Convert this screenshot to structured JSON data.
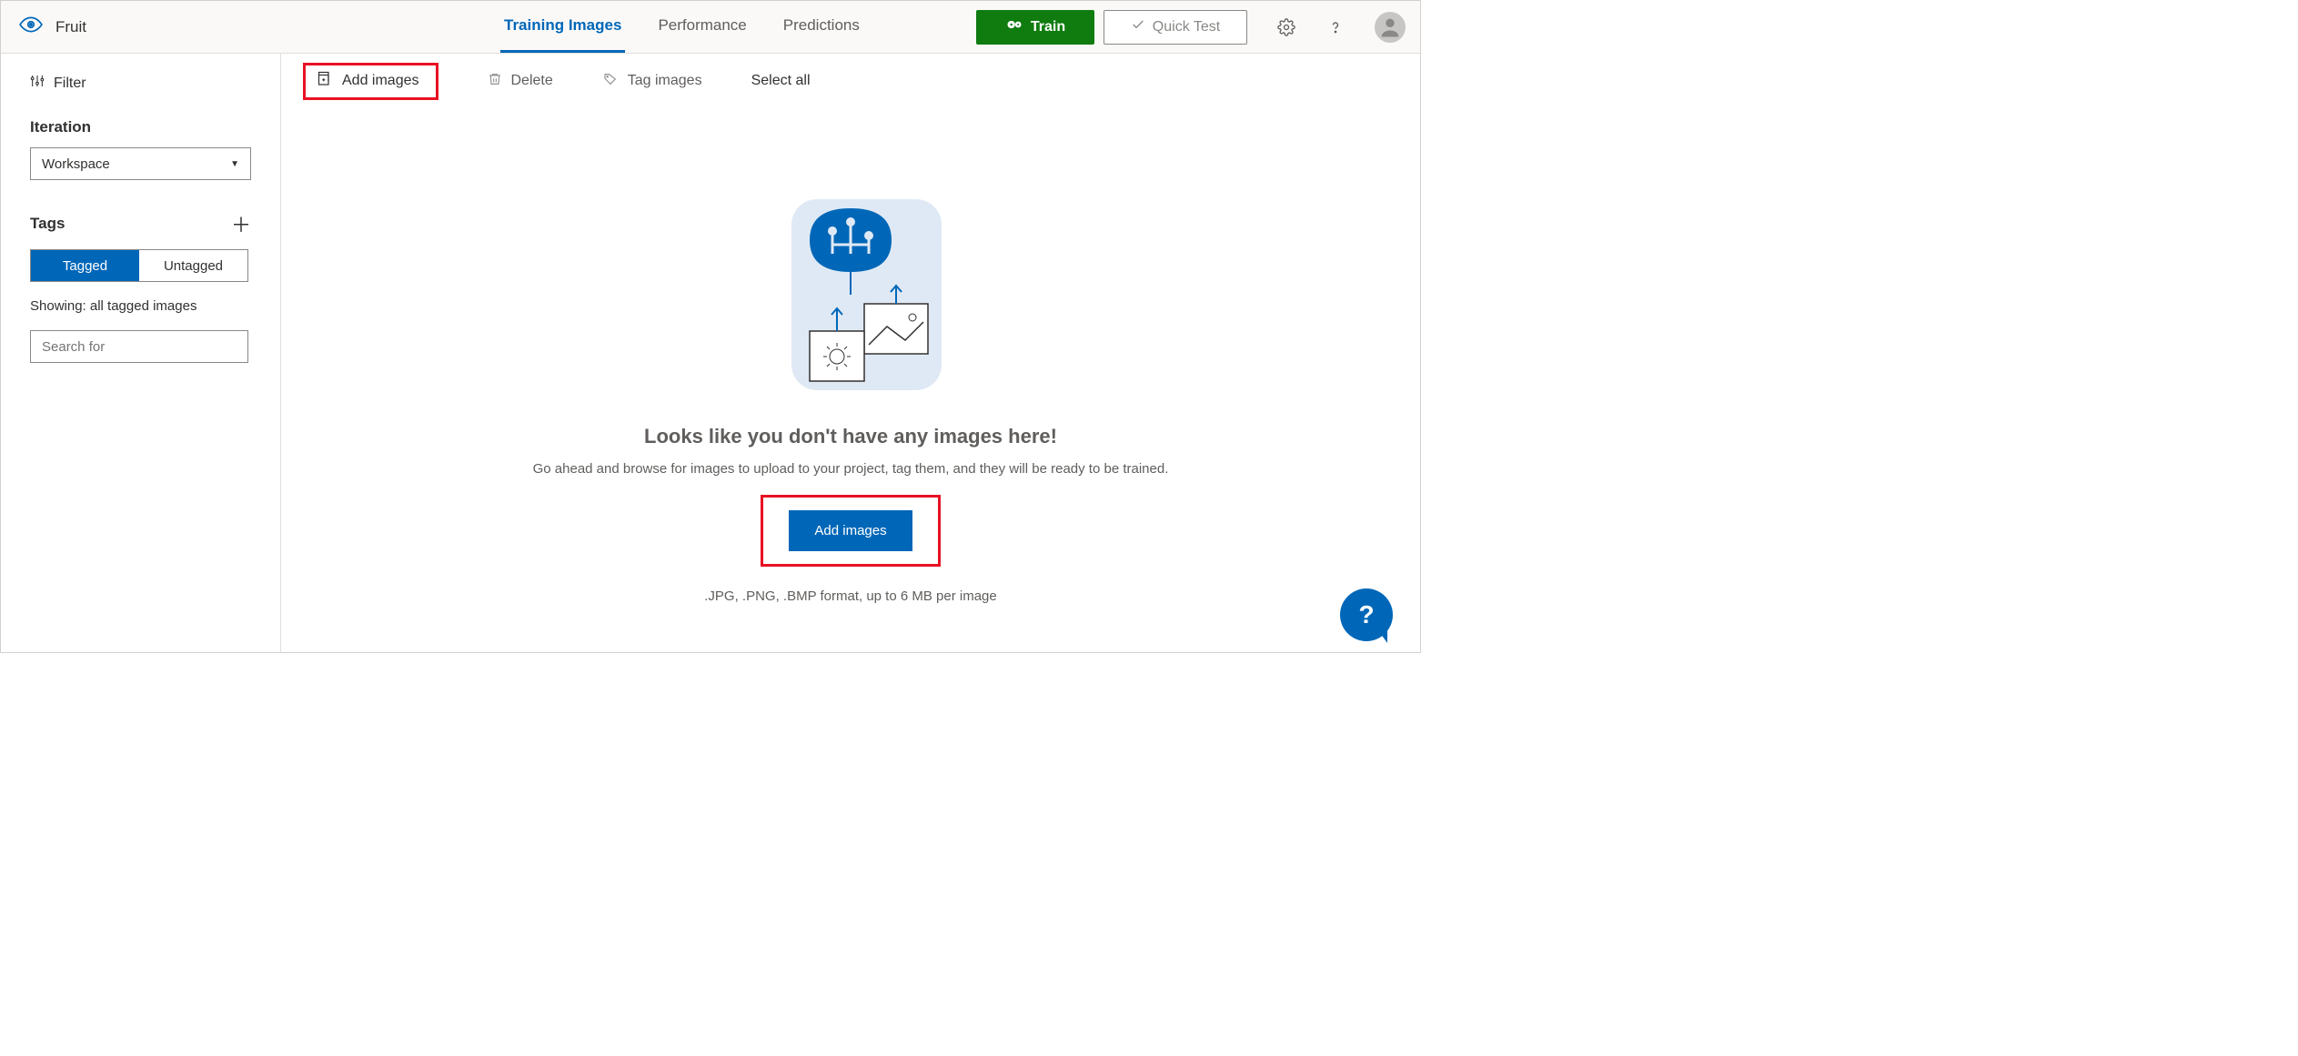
{
  "header": {
    "project_name": "Fruit",
    "tabs": {
      "training": "Training Images",
      "performance": "Performance",
      "predictions": "Predictions"
    },
    "train_button": "Train",
    "quick_test_button": "Quick Test"
  },
  "sidebar": {
    "filter_label": "Filter",
    "iteration_label": "Iteration",
    "iteration_value": "Workspace",
    "tags_label": "Tags",
    "seg_tagged": "Tagged",
    "seg_untagged": "Untagged",
    "showing_text": "Showing: all tagged images",
    "search_placeholder": "Search for"
  },
  "toolbar": {
    "add_images": "Add images",
    "delete": "Delete",
    "tag_images": "Tag images",
    "select_all": "Select all"
  },
  "empty": {
    "heading": "Looks like you don't have any images here!",
    "text": "Go ahead and browse for images to upload to your project, tag them, and they will be ready to be trained.",
    "cta": "Add images",
    "hint": ".JPG, .PNG, .BMP format, up to 6 MB per image"
  }
}
